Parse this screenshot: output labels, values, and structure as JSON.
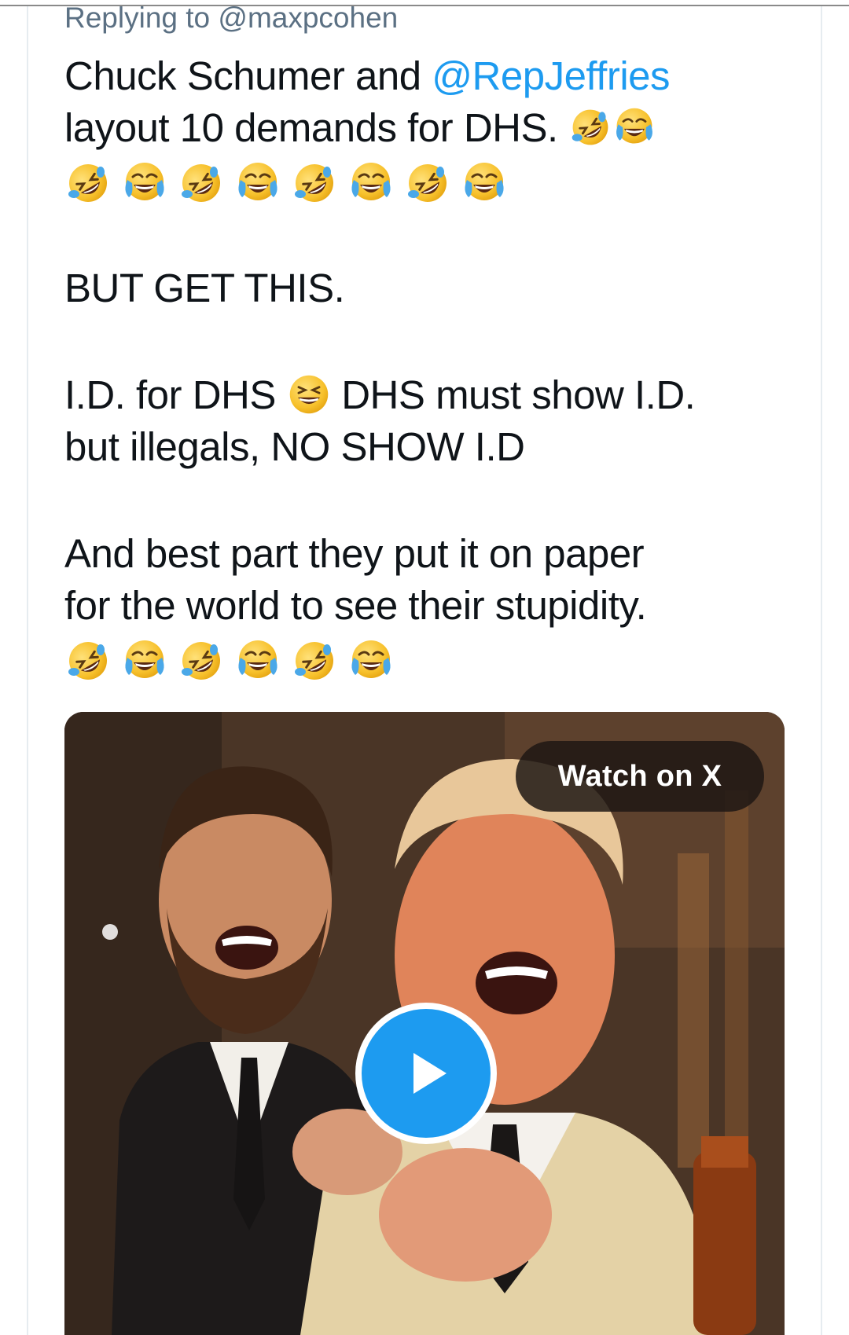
{
  "reply_context": {
    "prefix": "Replying to",
    "handle": "@maxpcohen"
  },
  "tweet": {
    "line1_a": "Chuck Schumer and ",
    "line1_mention": "@RepJeffries",
    "line2": "layout 10 demands for DHS.",
    "line3": "BUT GET THIS.",
    "line4_a": "I.D. for DHS",
    "line4_b": "DHS must show I.D.",
    "line5": "but illegals, NO SHOW I.D",
    "line6": "And best part they put it on paper",
    "line7": "for the world to see their stupidity."
  },
  "emojis": {
    "rofl": "rolling-on-floor-laughing-icon",
    "tears": "face-with-tears-of-joy-icon",
    "squint": "grinning-squinting-face-icon"
  },
  "media": {
    "watch_label": "Watch on X",
    "play_icon": "play-icon"
  },
  "colors": {
    "accent": "#1d9bf0",
    "muted": "#5b7083",
    "text": "#0f1419"
  }
}
